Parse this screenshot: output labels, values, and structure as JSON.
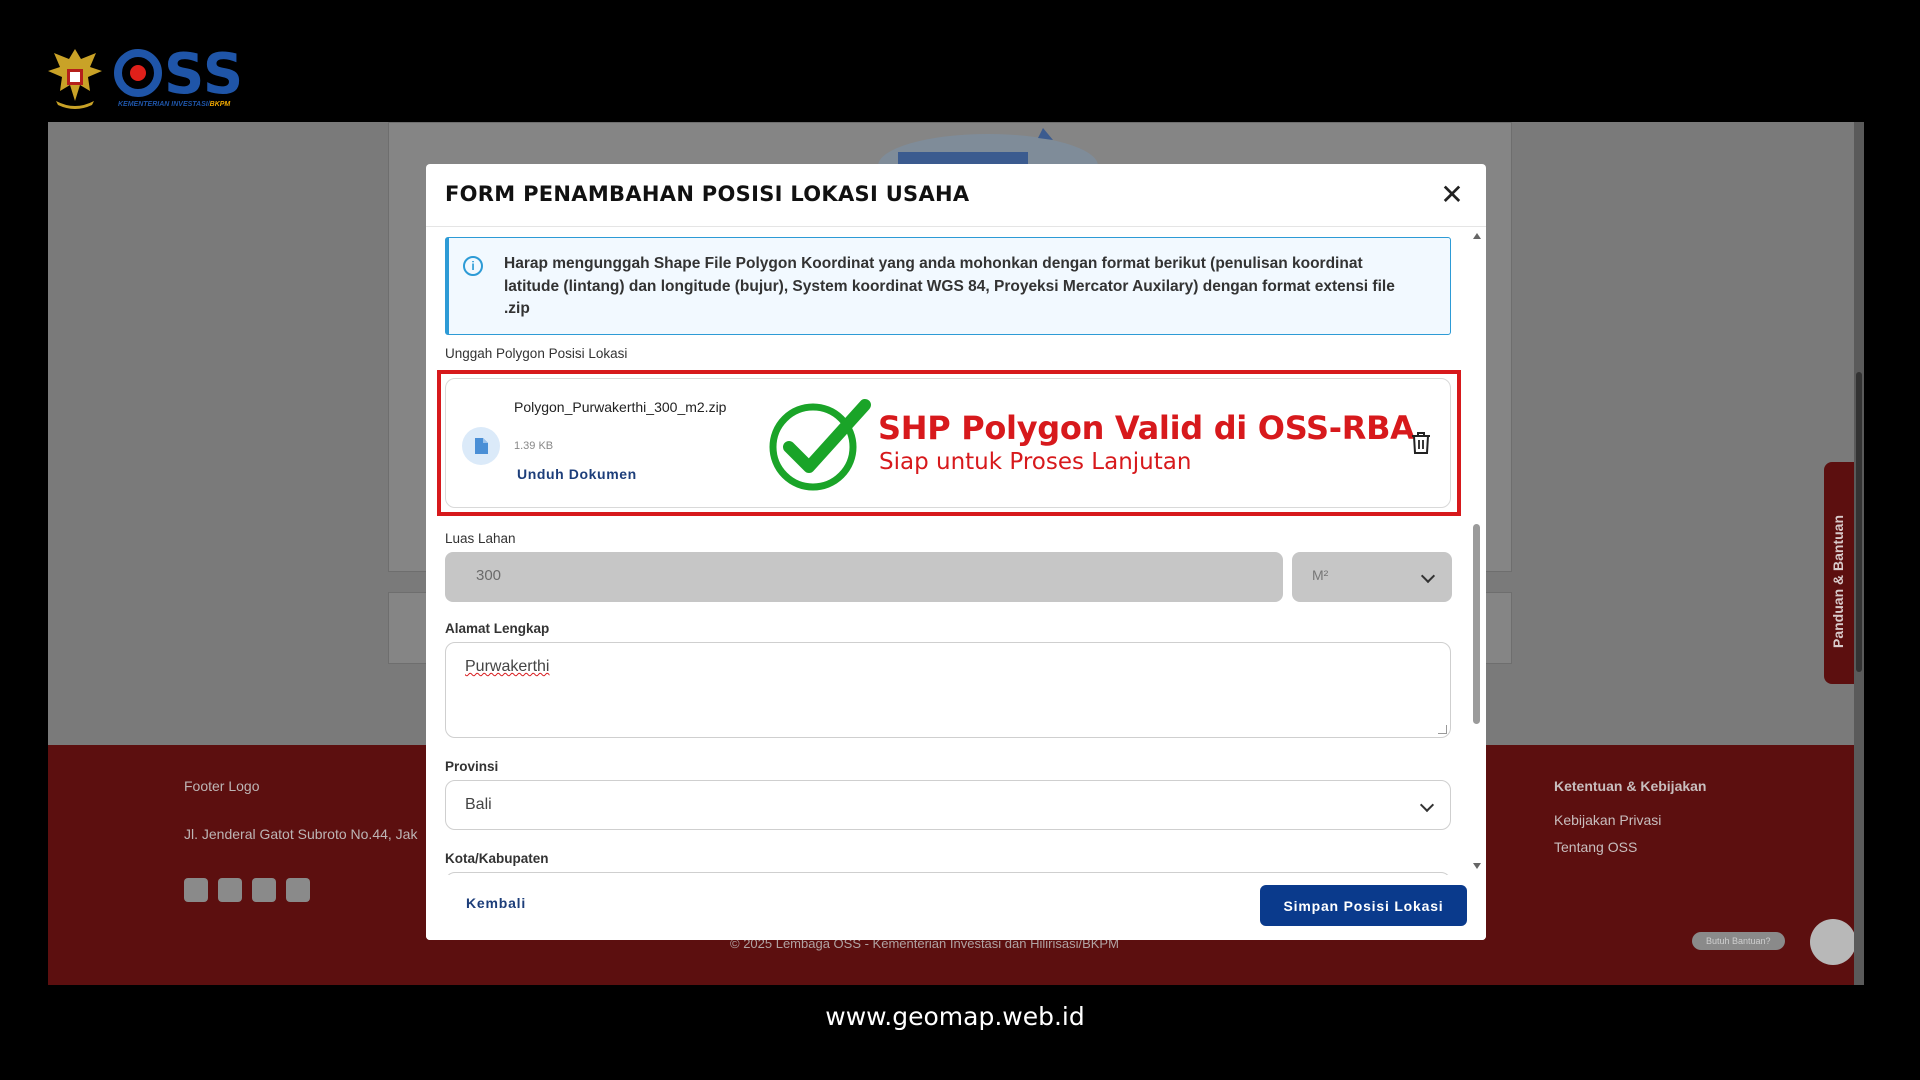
{
  "branding": {
    "logo_text": "OSS",
    "logo_subtitle_main": "KEMENTERIAN INVESTASI/",
    "logo_subtitle_accent": "BKPM",
    "emblem_icon": "garuda-emblem-icon"
  },
  "background_page": {
    "footer_logo_alt": "Footer Logo",
    "footer_address": "Jl. Jenderal Gatot Subroto No.44, Jak",
    "footer_policy_heading": "Ketentuan & Kebijakan",
    "footer_links": [
      "Kebijakan Privasi",
      "Tentang OSS"
    ],
    "copyright": "© 2025 Lembaga OSS - Kementerian Investasi dan Hilirisasi/BKPM",
    "help_pill": "Butuh Bantuan?",
    "side_tab_label": "Panduan & Bantuan",
    "footer_color": "#5c0f0f"
  },
  "modal": {
    "title": "FORM PENAMBAHAN POSISI LOKASI USAHA",
    "close_icon": "close-icon",
    "info_text": "Harap mengunggah Shape File Polygon Koordinat yang anda mohonkan dengan format berikut (penulisan koordinat latitude (lintang) dan longitude (bujur), System koordinat WGS 84, Proyeksi Mercator Auxilary) dengan format extensi file .zip",
    "upload_label": "Unggah Polygon Posisi Lokasi",
    "file": {
      "name": "Polygon_Purwakerthi_300_m2.zip",
      "size": "1.39 KB",
      "download_label": "Unduh Dokumen",
      "icon": "document-icon"
    },
    "validation": {
      "title": "SHP Polygon Valid di OSS-RBA",
      "subtitle": "Siap untuk Proses Lanjutan",
      "color": "#d7191c",
      "check_color": "#1aa428"
    },
    "area": {
      "label": "Luas Lahan",
      "value": "300",
      "unit": "M²"
    },
    "address": {
      "label": "Alamat Lengkap",
      "value": "Purwakerthi"
    },
    "province": {
      "label": "Provinsi",
      "value": "Bali"
    },
    "city": {
      "label": "Kota/Kabupaten",
      "value": ""
    },
    "back_label": "Kembali",
    "save_label": "Simpan Posisi Lokasi",
    "primary_color": "#0a3a8c"
  },
  "watermark": "www.geomap.web.id"
}
